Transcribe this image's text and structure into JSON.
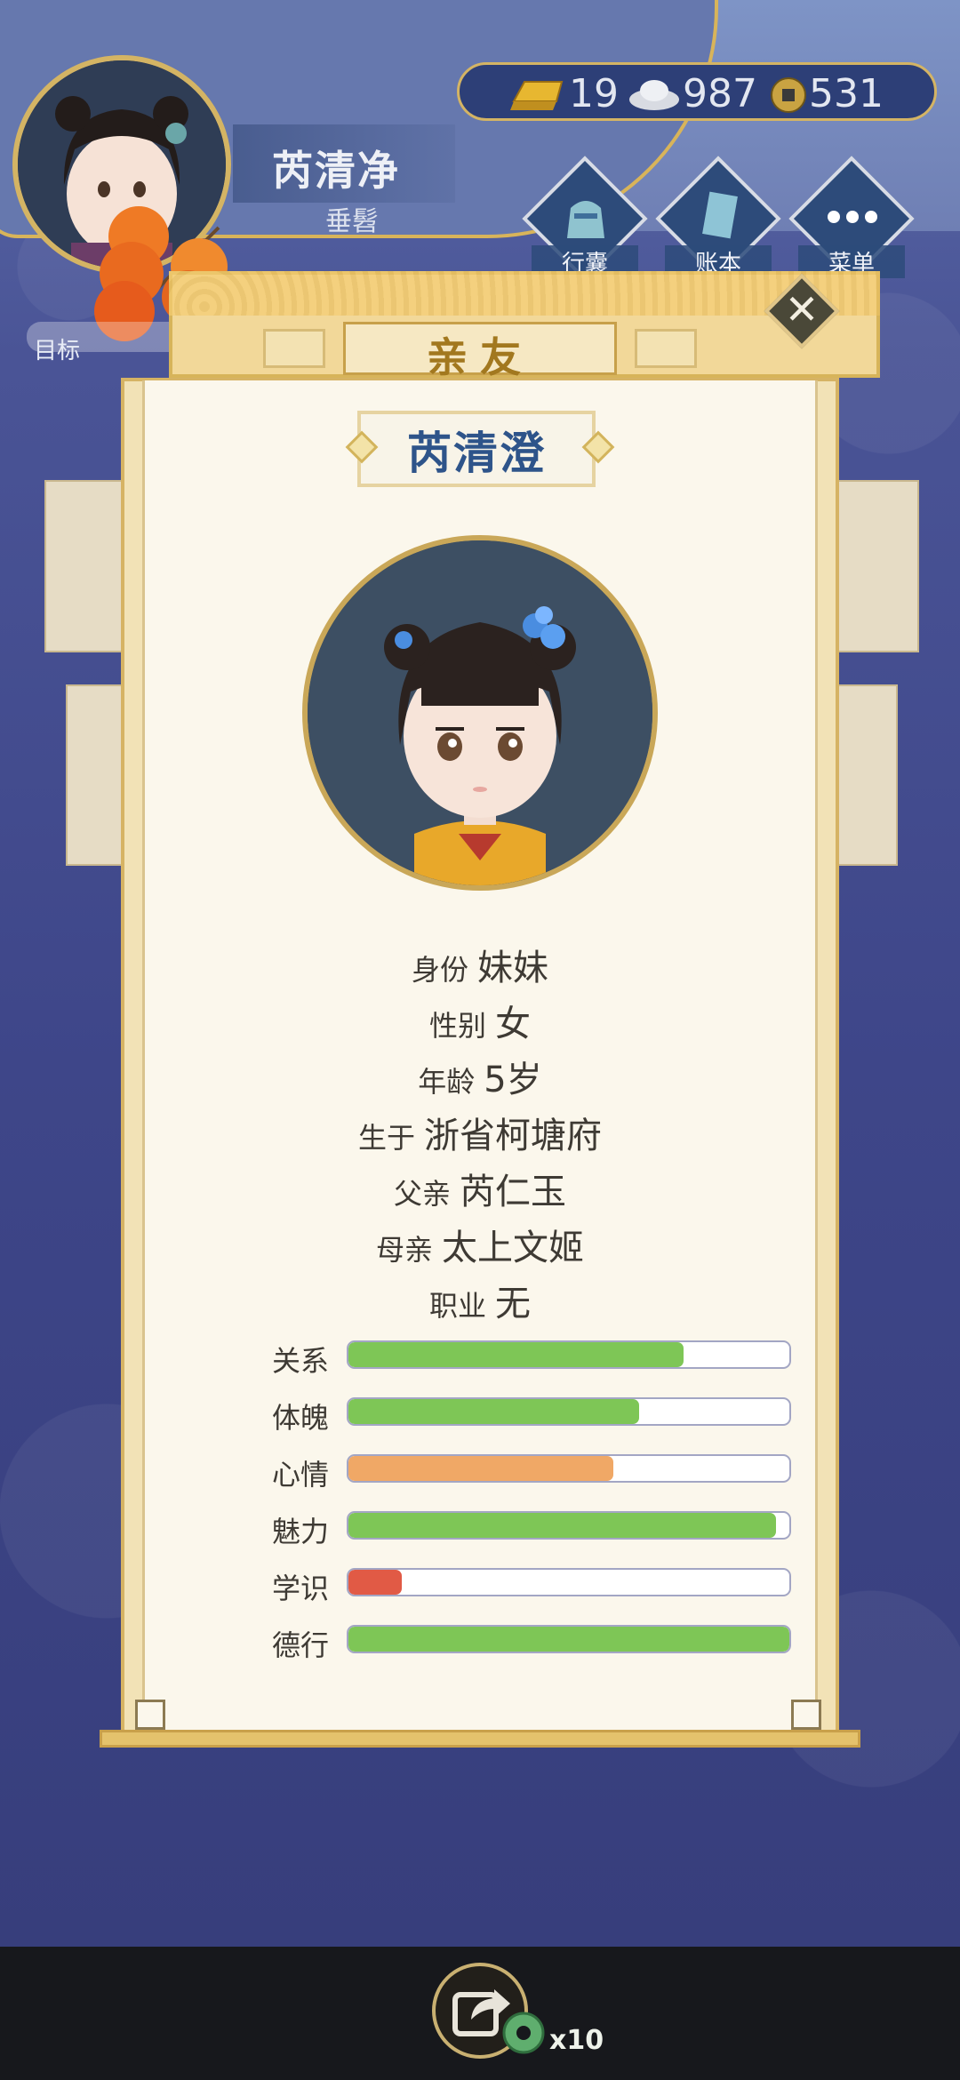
{
  "header": {
    "player_name": "芮清净",
    "player_subtitle": "垂髫",
    "target_label": "目标"
  },
  "currency": {
    "gold": "19",
    "silver": "987",
    "coin": "531",
    "gold_icon": "gold-ingot-icon",
    "silver_icon": "silver-ingot-icon",
    "coin_icon": "copper-coin-icon"
  },
  "menu": [
    {
      "label": "行囊",
      "icon": "bag-icon"
    },
    {
      "label": "账本",
      "icon": "ledger-icon"
    },
    {
      "label": "菜单",
      "icon": "menu-dots-icon"
    }
  ],
  "panel": {
    "title": "亲友",
    "close_icon": "close-icon",
    "name": "芮清澄",
    "info": [
      {
        "label": "身份",
        "value": "妹妹"
      },
      {
        "label": "性别",
        "value": "女"
      },
      {
        "label": "年龄",
        "value": "5岁"
      },
      {
        "label": "生于",
        "value": "浙省柯塘府"
      },
      {
        "label": "父亲",
        "value": "芮仁玉"
      },
      {
        "label": "母亲",
        "value": "太上文姬"
      },
      {
        "label": "职业",
        "value": "无"
      }
    ],
    "stats": [
      {
        "label": "关系",
        "fraction": 0.76,
        "color": "#7ec656"
      },
      {
        "label": "体魄",
        "fraction": 0.66,
        "color": "#7ec656"
      },
      {
        "label": "心情",
        "fraction": 0.6,
        "color": "#f0a866"
      },
      {
        "label": "魅力",
        "fraction": 0.97,
        "color": "#7ec656"
      },
      {
        "label": "学识",
        "fraction": 0.12,
        "color": "#e15a45"
      },
      {
        "label": "德行",
        "fraction": 1.0,
        "color": "#7ec656"
      }
    ]
  },
  "bottom": {
    "share_icon": "share-icon",
    "share_count": "x10"
  }
}
